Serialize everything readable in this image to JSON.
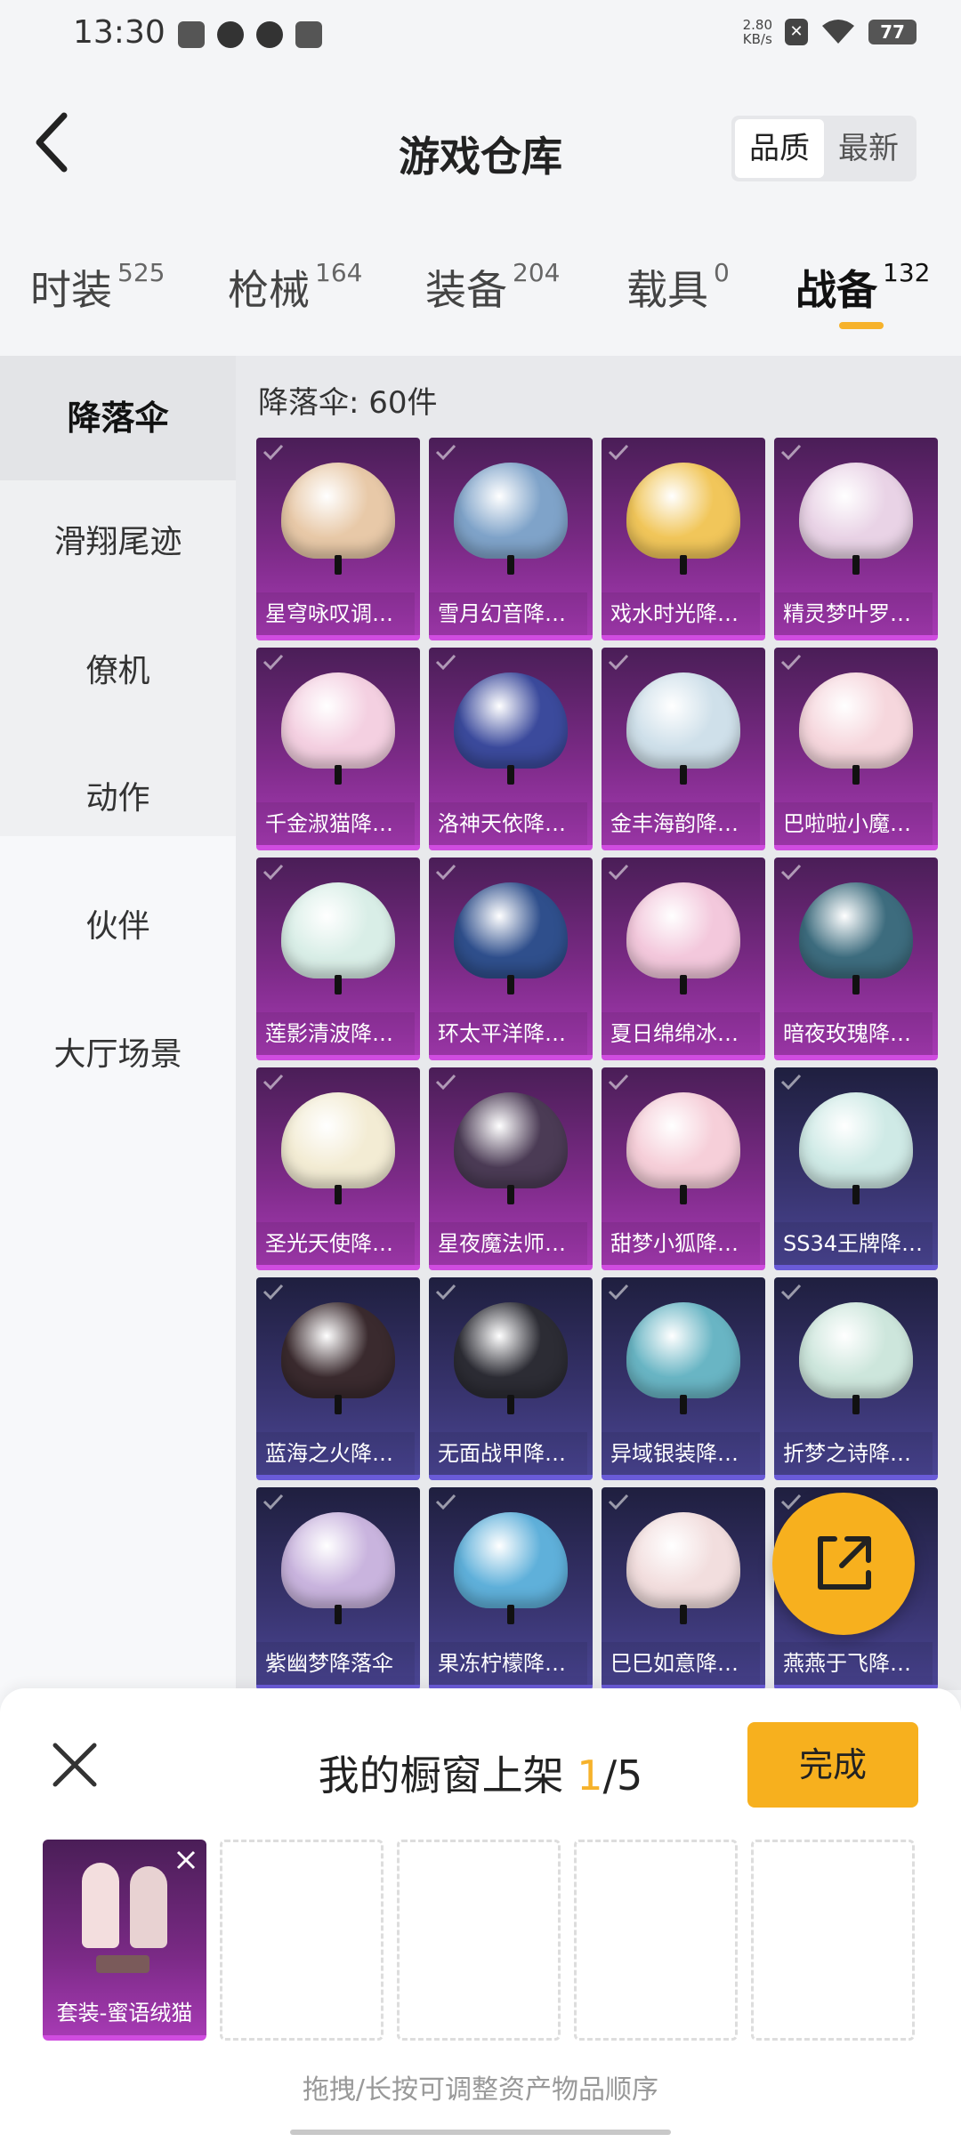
{
  "status_bar": {
    "time": "13:30",
    "net_speed_value": "2.80",
    "net_speed_unit": "KB/s",
    "battery": "77"
  },
  "header": {
    "title": "游戏仓库",
    "sort_options": [
      "品质",
      "最新"
    ],
    "sort_active": "品质"
  },
  "category_tabs": [
    {
      "label": "时装",
      "count": "525"
    },
    {
      "label": "枪械",
      "count": "164"
    },
    {
      "label": "装备",
      "count": "204"
    },
    {
      "label": "载具",
      "count": "0"
    },
    {
      "label": "战备",
      "count": "132"
    }
  ],
  "active_category": "战备",
  "sidebar": {
    "items": [
      "降落伞",
      "滑翔尾迹",
      "僚机",
      "动作",
      "伙伴",
      "大厅场景"
    ],
    "active": "降落伞"
  },
  "list": {
    "heading": "降落伞: 60件",
    "items": [
      {
        "name": "星穹咏叹调…",
        "rarity": "purple",
        "color": "#e8c9a8"
      },
      {
        "name": "雪月幻音降…",
        "rarity": "purple",
        "color": "#7fa3c9"
      },
      {
        "name": "戏水时光降…",
        "rarity": "purple",
        "color": "#f1c65a"
      },
      {
        "name": "精灵梦叶罗…",
        "rarity": "purple",
        "color": "#e9d3e6"
      },
      {
        "name": "千金淑猫降…",
        "rarity": "purple",
        "color": "#f4d0e1"
      },
      {
        "name": "洛神天依降…",
        "rarity": "purple",
        "color": "#3b4a9c"
      },
      {
        "name": "金丰海韵降…",
        "rarity": "purple",
        "color": "#cfe0ea"
      },
      {
        "name": "巴啦啦小魔…",
        "rarity": "purple",
        "color": "#f6d7dd"
      },
      {
        "name": "莲影清波降…",
        "rarity": "purple",
        "color": "#d9eee7"
      },
      {
        "name": "环太平洋降…",
        "rarity": "purple",
        "color": "#2f4f8c"
      },
      {
        "name": "夏日绵绵冰…",
        "rarity": "purple",
        "color": "#f3c8dc"
      },
      {
        "name": "暗夜玫瑰降…",
        "rarity": "purple",
        "color": "#3d6c7e"
      },
      {
        "name": "圣光天使降…",
        "rarity": "purple",
        "color": "#f3ecd4"
      },
      {
        "name": "星夜魔法师…",
        "rarity": "purple",
        "color": "#4b3b55"
      },
      {
        "name": "甜梦小狐降…",
        "rarity": "purple",
        "color": "#f6cfd9"
      },
      {
        "name": "SS34王牌降…",
        "rarity": "blue",
        "color": "#cfeae6"
      },
      {
        "name": "蓝海之火降…",
        "rarity": "blue",
        "color": "#3a2a2e"
      },
      {
        "name": "无面战甲降…",
        "rarity": "blue",
        "color": "#2c2c34"
      },
      {
        "name": "异域银装降…",
        "rarity": "blue",
        "color": "#69b5c4"
      },
      {
        "name": "折梦之诗降…",
        "rarity": "blue",
        "color": "#cde6dc"
      },
      {
        "name": "紫幽梦降落伞",
        "rarity": "blue",
        "color": "#c9b4de"
      },
      {
        "name": "果冻柠檬降…",
        "rarity": "blue",
        "color": "#5fb0da"
      },
      {
        "name": "巳巳如意降…",
        "rarity": "blue",
        "color": "#f2dede"
      },
      {
        "name": "燕燕于飞降…",
        "rarity": "blue",
        "color": "#9bb7d8"
      }
    ]
  },
  "showcase": {
    "title_prefix": "我的橱窗上架 ",
    "selected_count": "1",
    "max_suffix": "/5",
    "done_label": "完成",
    "slots": [
      {
        "name": "套装-蜜语绒猫",
        "filled": true
      },
      {
        "name": "",
        "filled": false
      },
      {
        "name": "",
        "filled": false
      },
      {
        "name": "",
        "filled": false
      },
      {
        "name": "",
        "filled": false
      }
    ],
    "hint": "拖拽/长按可调整资产物品顺序"
  },
  "colors": {
    "accent": "#f7b01e",
    "epic_purple": "#a63ab3",
    "rare_blue": "#4a4593"
  }
}
